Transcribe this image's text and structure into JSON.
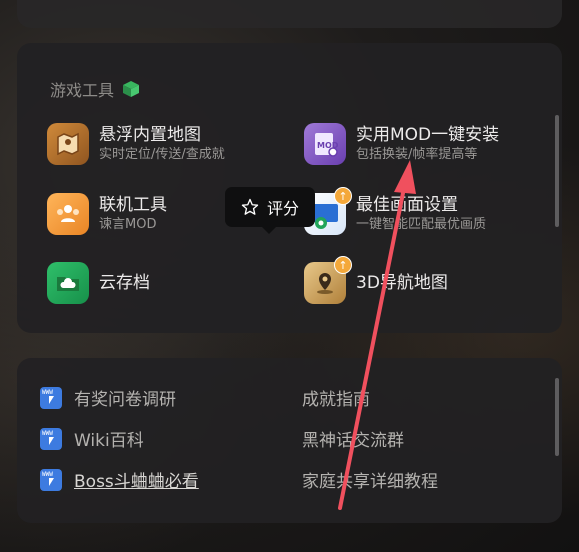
{
  "tools_section": {
    "title": "游戏工具",
    "items": [
      {
        "name": "悬浮内置地图",
        "desc": "实时定位/传送/查成就",
        "icon": "map-icon",
        "color": "#b8732a"
      },
      {
        "name": "实用MOD一键安装",
        "desc": "包括换装/帧率提高等",
        "icon": "mod-icon",
        "color": "#8a5fc8"
      },
      {
        "name": "联机工具",
        "desc": "谏言MOD",
        "icon": "multiplayer-icon",
        "color": "#f29a3a"
      },
      {
        "name": "最佳画面设置",
        "desc": "一键智能匹配最优画质",
        "icon": "display-settings-icon",
        "color": "#2a6fd4"
      },
      {
        "name": "云存档",
        "desc": "",
        "icon": "cloud-save-icon",
        "color": "#22a55a"
      },
      {
        "name": "3D导航地图",
        "desc": "",
        "icon": "3d-map-icon",
        "color": "#c89a4a"
      }
    ]
  },
  "tooltip": {
    "label": "评分",
    "icon": "star-icon"
  },
  "links_section": {
    "left": [
      "有奖问卷调研",
      "Wiki百科",
      "Boss斗蛐蛐必看"
    ],
    "right": [
      "成就指南",
      "黑神话交流群",
      "家庭共享详细教程"
    ]
  }
}
